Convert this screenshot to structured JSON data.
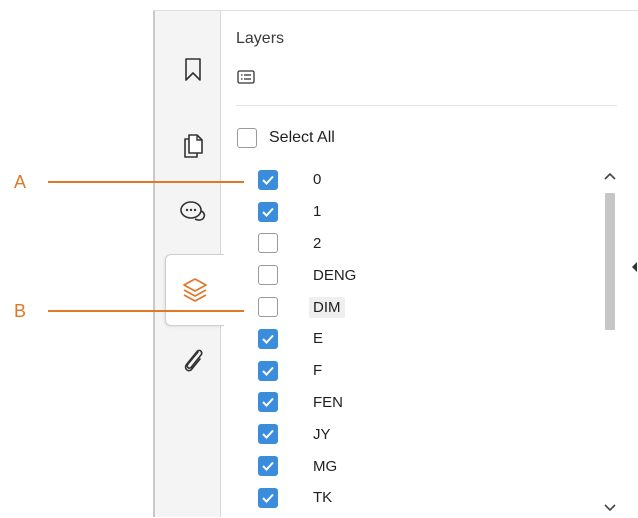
{
  "panel": {
    "title": "Layers",
    "select_all_label": "Select All",
    "select_all_checked": false
  },
  "rail": {
    "items": [
      {
        "icon": "bookmark-icon",
        "active": false
      },
      {
        "icon": "pages-icon",
        "active": false
      },
      {
        "icon": "comments-icon",
        "active": false
      },
      {
        "icon": "layers-icon",
        "active": true
      },
      {
        "icon": "attachment-icon",
        "active": false
      }
    ]
  },
  "layers": [
    {
      "name": "0",
      "checked": true
    },
    {
      "name": "1",
      "checked": true
    },
    {
      "name": "2",
      "checked": false
    },
    {
      "name": "DENG",
      "checked": false
    },
    {
      "name": "DIM",
      "checked": false
    },
    {
      "name": "E",
      "checked": true
    },
    {
      "name": "F",
      "checked": true
    },
    {
      "name": "FEN",
      "checked": true
    },
    {
      "name": "JY",
      "checked": true
    },
    {
      "name": "MG",
      "checked": true
    },
    {
      "name": "TK",
      "checked": true
    }
  ],
  "callouts": {
    "a": "A",
    "b": "B"
  },
  "colors": {
    "accent": "#e0782a",
    "checkbox_checked": "#3b8ddc"
  }
}
